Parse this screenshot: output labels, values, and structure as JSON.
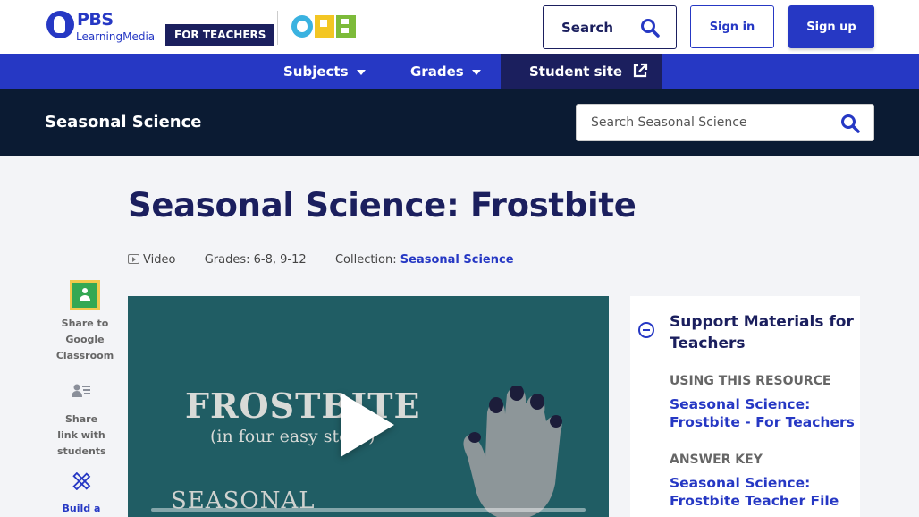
{
  "header": {
    "logo_pbs": "PBS",
    "logo_lm": "LearningMedia",
    "for_teachers": "FOR TEACHERS",
    "search_label": "Search",
    "signin_label": "Sign in",
    "signup_label": "Sign up"
  },
  "nav": {
    "subjects": "Subjects",
    "grades": "Grades",
    "student_site": "Student site"
  },
  "collection_bar": {
    "title": "Seasonal Science",
    "search_placeholder": "Search Seasonal Science"
  },
  "resource": {
    "title": "Seasonal Science: Frostbite",
    "type": "Video",
    "grades_label": "Grades:",
    "grades_value": "6-8, 9-12",
    "collection_label": "Collection:",
    "collection_value": "Seasonal Science"
  },
  "share": {
    "google_classroom": "Share to Google Classroom",
    "share_link": "Share link with students",
    "build": "Build a"
  },
  "video": {
    "frame_title": "FROSTBITE",
    "frame_subtitle": "(in four easy steps)",
    "frame_bottom": "SEASONAL"
  },
  "support": {
    "title": "Support Materials for Teachers",
    "section1_label": "USING THIS RESOURCE",
    "section1_link": "Seasonal Science: Frostbite - For Teachers",
    "section2_label": "ANSWER KEY",
    "section2_link": "Seasonal Science: Frostbite Teacher File"
  },
  "colors": {
    "brand_blue": "#2638c4",
    "navy": "#1b1f5e",
    "dark_bar": "#0b1b33"
  }
}
